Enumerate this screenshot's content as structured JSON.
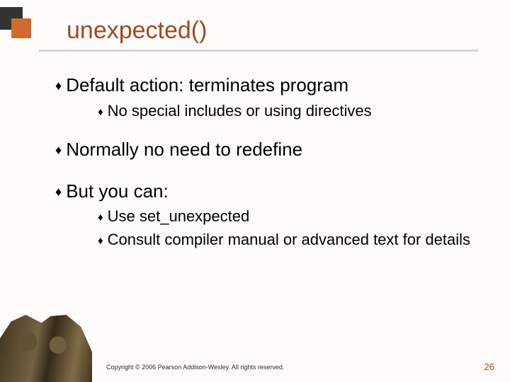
{
  "title": "unexpected()",
  "bullets": {
    "b1": "Default action: terminates program",
    "b1a": "No special includes or using directives",
    "b2": "Normally no need to redefine",
    "b3": "But you can:",
    "b3a": "Use set_unexpected",
    "b3b": "Consult compiler manual or advanced text for details"
  },
  "footer": {
    "copyright": "Copyright © 2006 Pearson Addison-Wesley. All rights reserved.",
    "page": "26"
  }
}
